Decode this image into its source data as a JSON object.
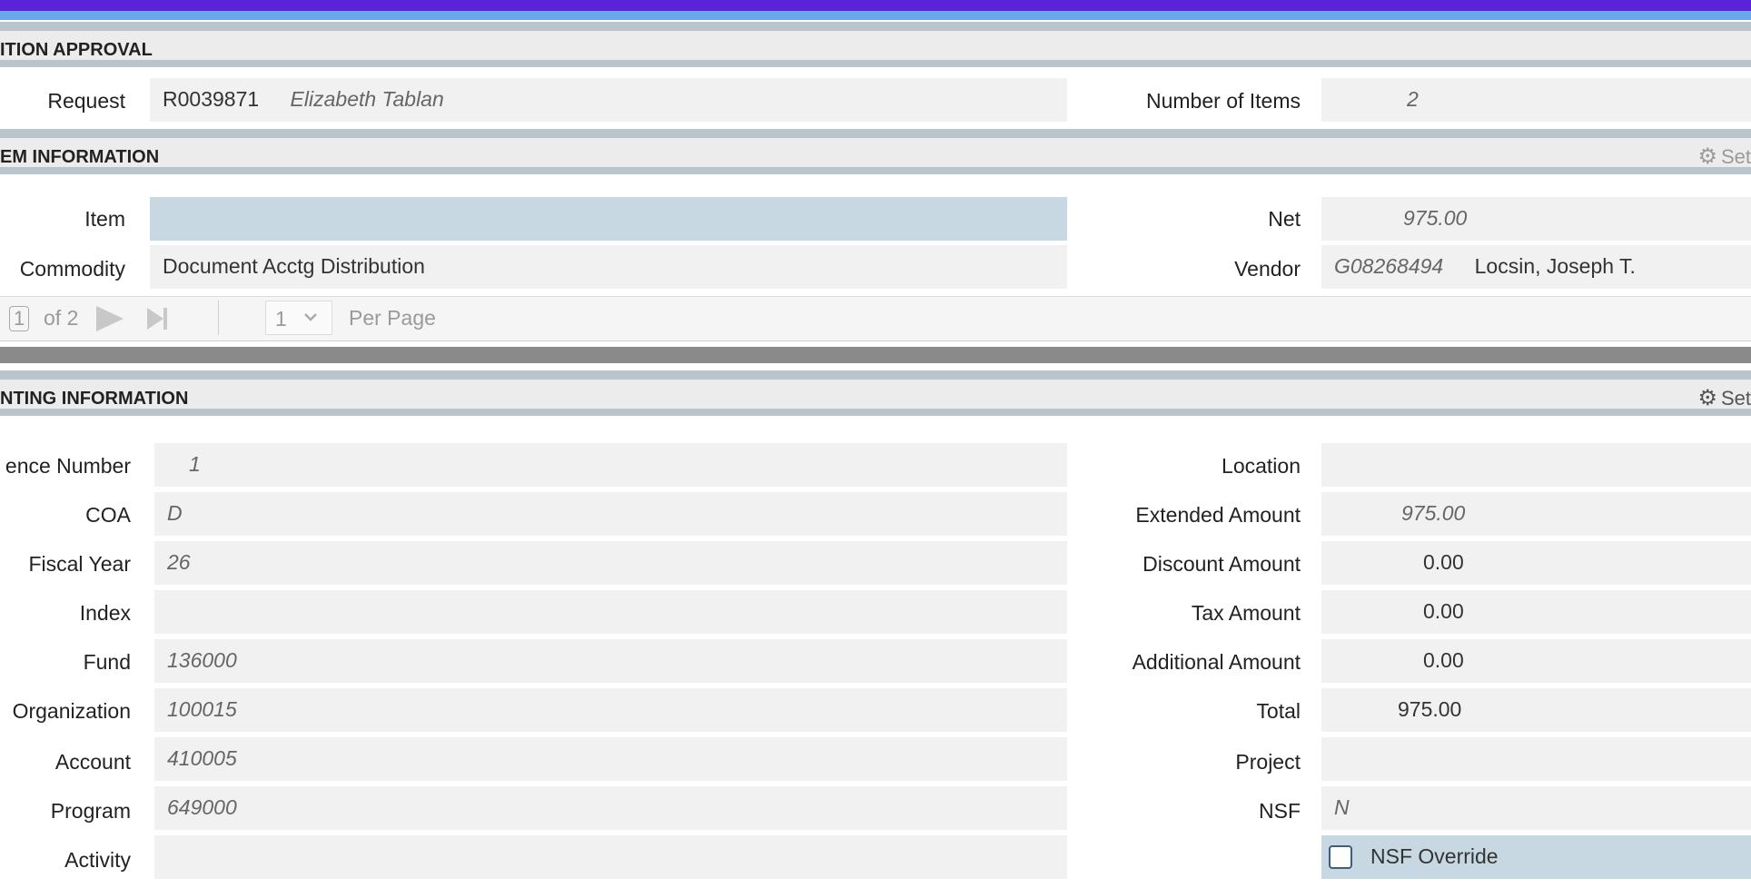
{
  "approval": {
    "title": "ITION APPROVAL",
    "request_label": "Request",
    "request_id": "R0039871",
    "requester": "Elizabeth Tablan",
    "items_label": "Number of Items",
    "items_value": "2"
  },
  "item_info": {
    "title": "EM INFORMATION",
    "settings_label": "Set",
    "item_label": "Item",
    "item_value": "",
    "commodity_label": "Commodity",
    "commodity_value": "Document Acctg Distribution",
    "net_label": "Net",
    "net_value": "975.00",
    "vendor_label": "Vendor",
    "vendor_id": "G08268494",
    "vendor_name": "Locsin, Joseph T."
  },
  "pager": {
    "current_page": "1",
    "of_text": "of 2",
    "per_page_value": "1",
    "per_page_label": "Per Page"
  },
  "accounting": {
    "title": "NTING INFORMATION",
    "settings_label": "Set",
    "left_fields": [
      {
        "label": "ence Number",
        "value": "1"
      },
      {
        "label": "COA",
        "value": "D"
      },
      {
        "label": "Fiscal Year",
        "value": "26"
      },
      {
        "label": "Index",
        "value": ""
      },
      {
        "label": "Fund",
        "value": "136000"
      },
      {
        "label": "Organization",
        "value": "100015"
      },
      {
        "label": "Account",
        "value": "410005"
      },
      {
        "label": "Program",
        "value": "649000"
      },
      {
        "label": "Activity",
        "value": ""
      }
    ],
    "right_fields": [
      {
        "label": "Location",
        "value": ""
      },
      {
        "label": "Extended Amount",
        "value": "975.00"
      },
      {
        "label": "Discount Amount",
        "value": "0.00"
      },
      {
        "label": "Tax Amount",
        "value": "0.00"
      },
      {
        "label": "Additional Amount",
        "value": "0.00"
      },
      {
        "label": "Total",
        "value": "975.00"
      },
      {
        "label": "Project",
        "value": ""
      },
      {
        "label": "NSF",
        "value": "N"
      }
    ],
    "nsf_override_label": "NSF Override"
  },
  "colors": {
    "accent_purple": "#5b22d8",
    "accent_blue": "#6aa8ec",
    "highlight_field": "#c7d8e3"
  }
}
